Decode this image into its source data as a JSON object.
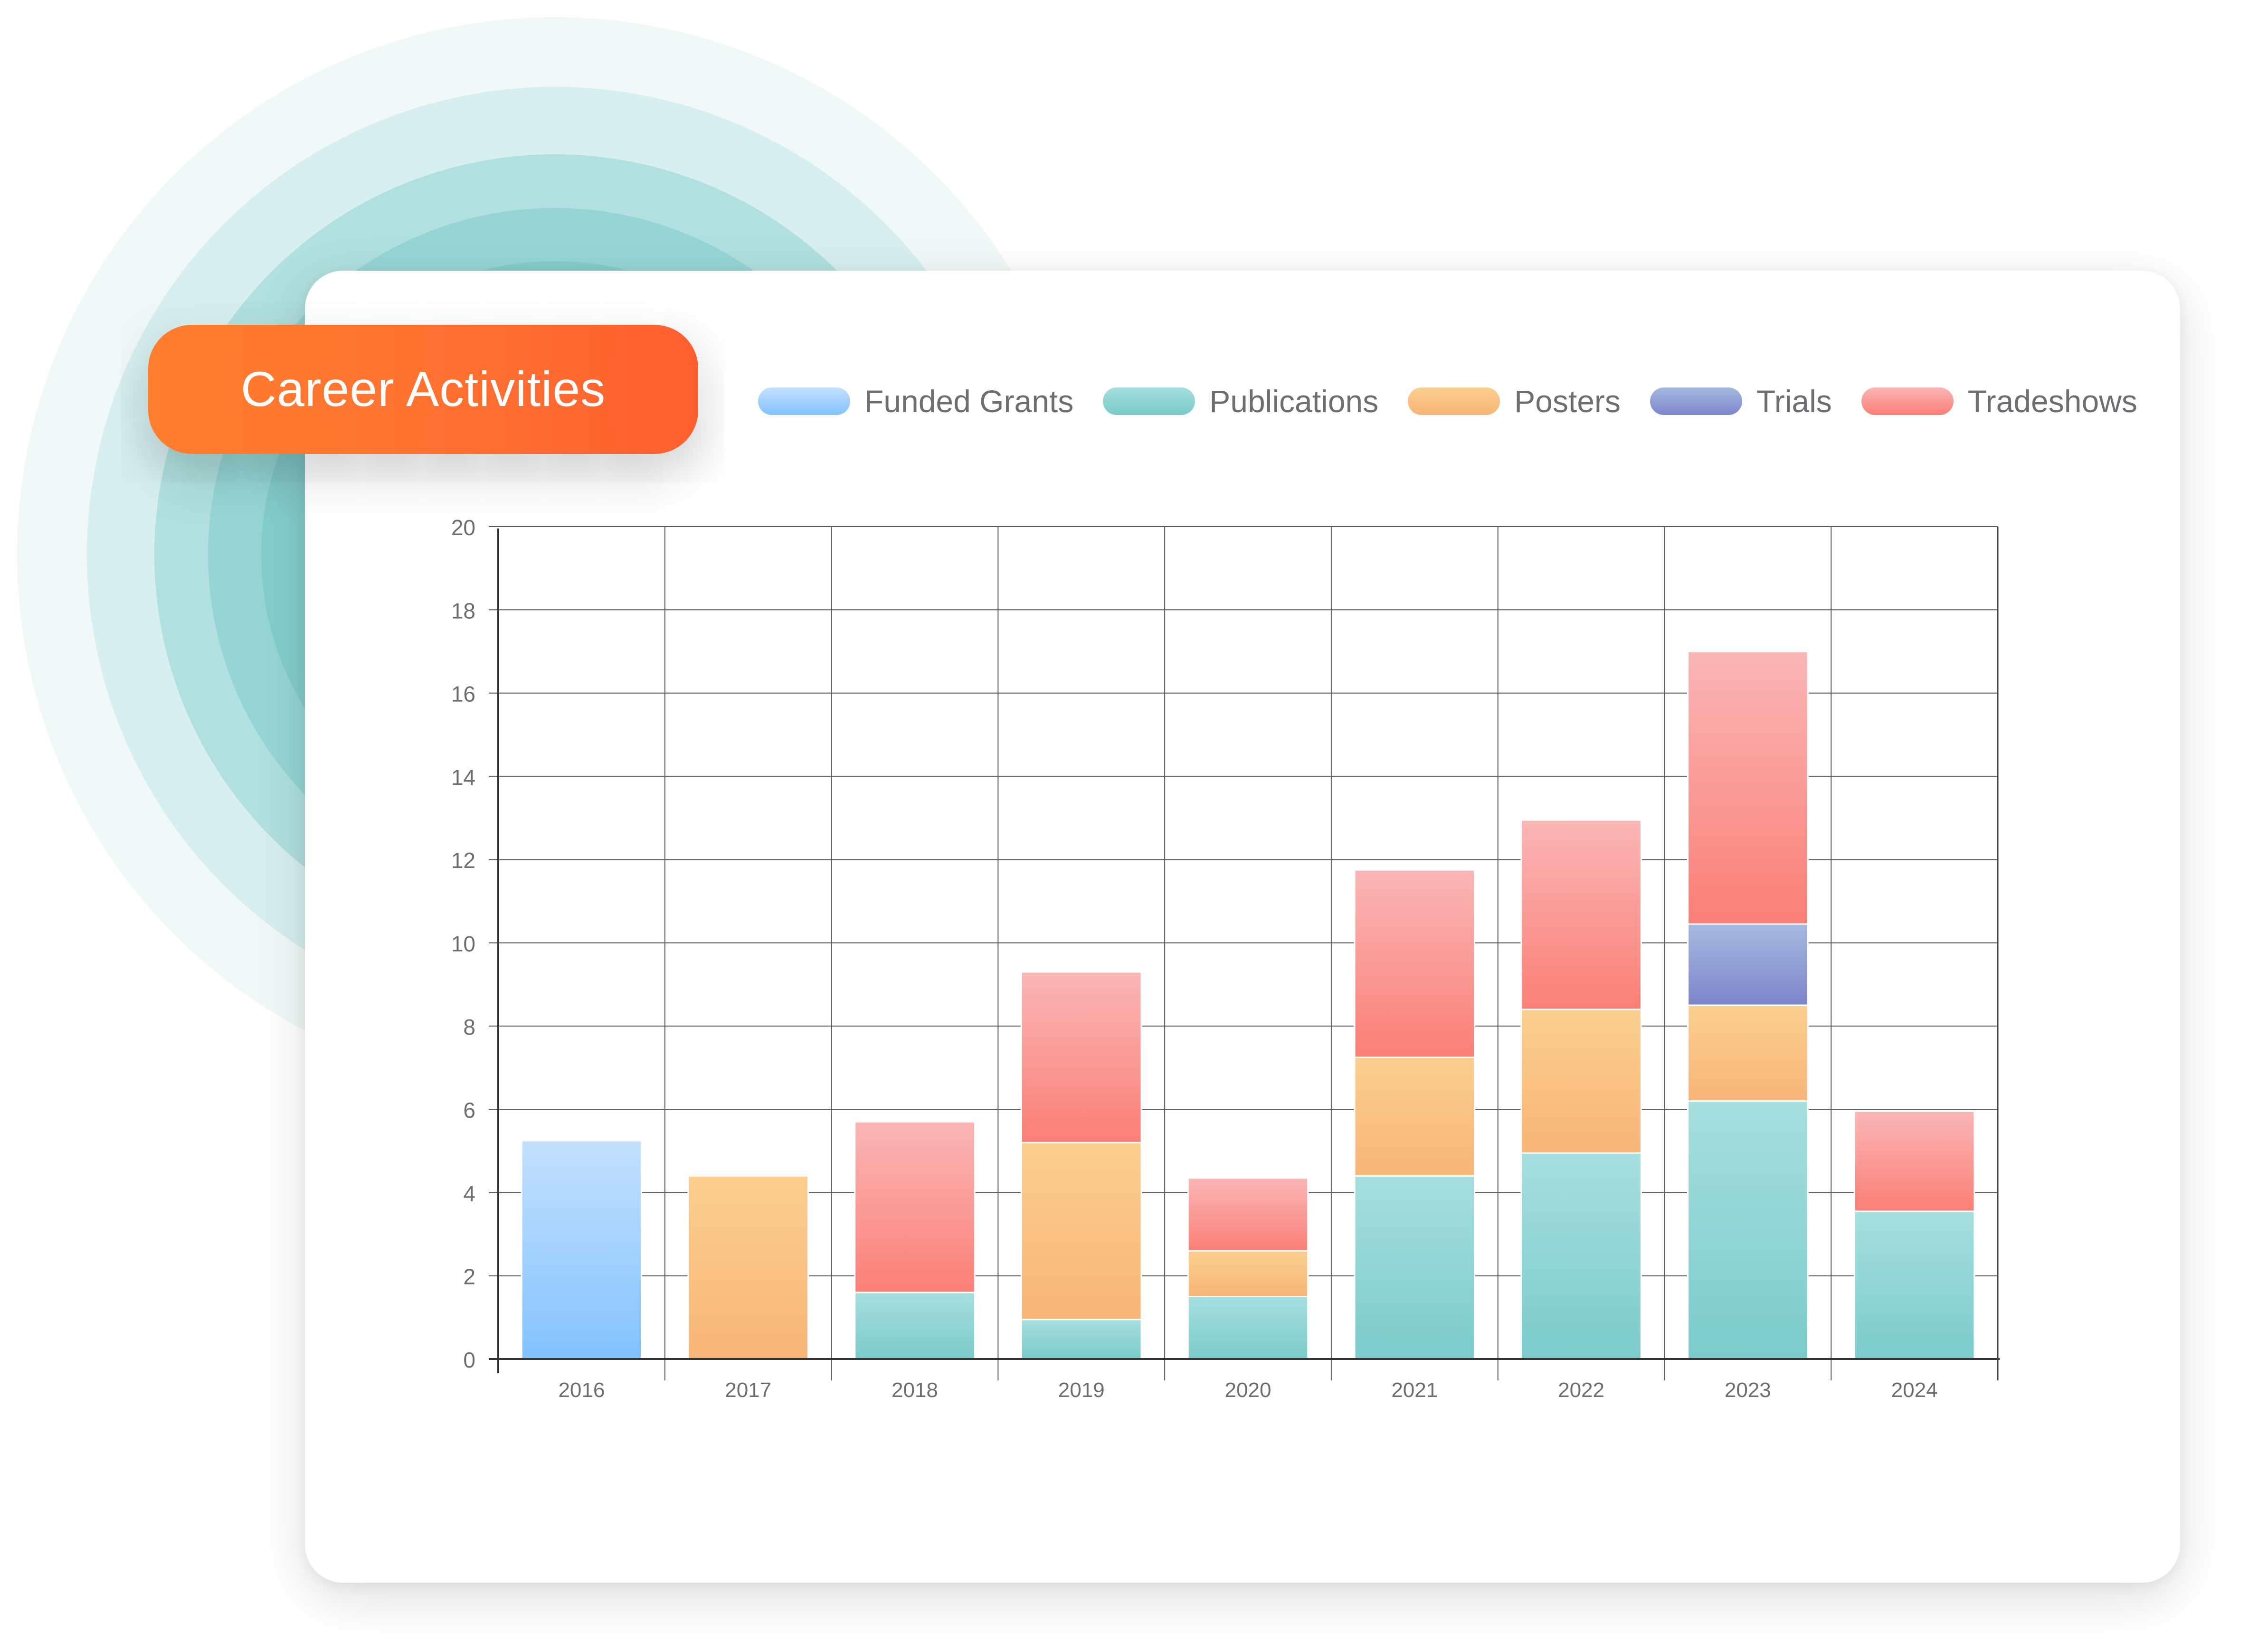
{
  "title": "Career Activities",
  "colors": {
    "badge_start": "#FF7F2E",
    "badge_end": "#FF6030",
    "rings": [
      "#F0F9F8",
      "#D7EFEF",
      "#B0E0DF",
      "#95D6D4",
      "#84CDCB"
    ]
  },
  "legend": [
    {
      "label": "Funded Grants",
      "color_top": "#C4E1FE",
      "color_bottom": "#83C2FE"
    },
    {
      "label": "Publications",
      "color_top": "#A6DFDE",
      "color_bottom": "#7ACBCA"
    },
    {
      "label": "Posters",
      "color_top": "#FACF8F",
      "color_bottom": "#F8B577"
    },
    {
      "label": "Trials",
      "color_top": "#A5B9DE",
      "color_bottom": "#7E85CC"
    },
    {
      "label": "Tradeshows",
      "color_top": "#FAB6B6",
      "color_bottom": "#FA7F76"
    }
  ],
  "chart_data": {
    "type": "bar",
    "stacked": true,
    "title": "Career Activities",
    "xlabel": "",
    "ylabel": "",
    "categories": [
      "2016",
      "2017",
      "2018",
      "2019",
      "2020",
      "2021",
      "2022",
      "2023",
      "2024"
    ],
    "series": [
      {
        "name": "Funded Grants",
        "values": [
          5.25,
          0,
          0,
          0,
          0,
          0,
          0,
          0,
          0
        ]
      },
      {
        "name": "Publications",
        "values": [
          0,
          0,
          1.6,
          0.95,
          1.5,
          4.4,
          4.95,
          6.2,
          3.55
        ]
      },
      {
        "name": "Posters",
        "values": [
          0,
          4.4,
          0,
          4.25,
          1.1,
          2.85,
          3.45,
          2.3,
          0
        ]
      },
      {
        "name": "Trials",
        "values": [
          0,
          0,
          0,
          0,
          0,
          0,
          0,
          1.95,
          0
        ]
      },
      {
        "name": "Tradeshows",
        "values": [
          0,
          0,
          4.1,
          4.1,
          1.75,
          4.5,
          4.55,
          6.55,
          2.4
        ]
      }
    ],
    "ylim": [
      0,
      20
    ],
    "yticks": [
      0,
      2,
      4,
      6,
      8,
      10,
      12,
      14,
      16,
      18,
      20
    ],
    "grid": true,
    "legend_position": "top-right"
  }
}
